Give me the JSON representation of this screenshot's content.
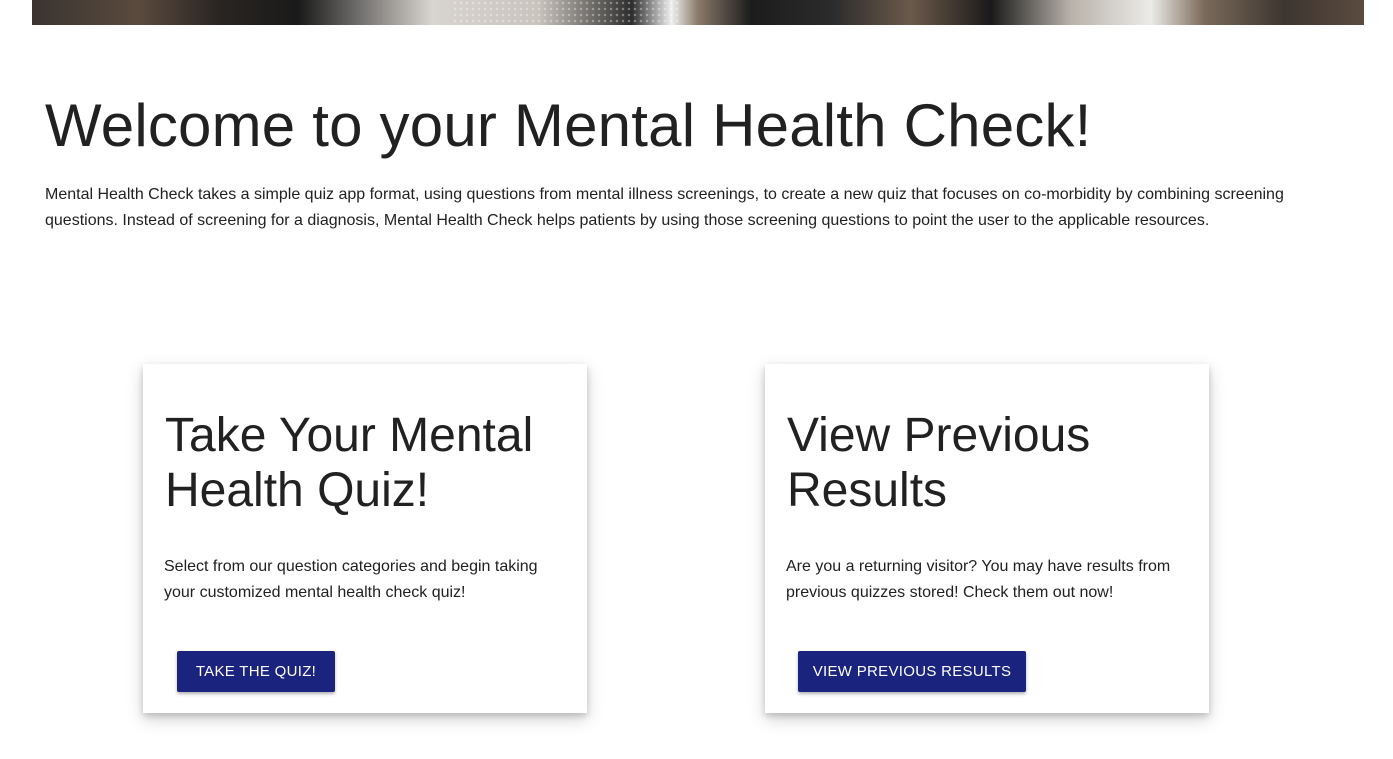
{
  "hero": {
    "image_name": "hero-photo",
    "colors": [
      "#3a3430",
      "#1a1a1a",
      "#d8d4cf",
      "#ecebe8"
    ]
  },
  "header": {
    "title": "Welcome to your Mental Health Check!"
  },
  "intro": {
    "text": "Mental Health Check takes a simple quiz app format, using questions from mental illness screenings, to create a new quiz that focuses on co-morbidity by combining screening questions. Instead of screening for a diagnosis, Mental Health Check helps patients by using those screening questions to point the user to the applicable resources."
  },
  "cards": [
    {
      "title": "Take Your Mental Health Quiz!",
      "description": "Select from our question categories and begin taking your customized mental health check quiz!",
      "button_label": "Take the Quiz!"
    },
    {
      "title": "View Previous Results",
      "description": "Are you a returning visitor? You may have results from previous quizzes stored! Check them out now!",
      "button_label": "View Previous Results"
    }
  ],
  "colors": {
    "button_bg": "#1a237e",
    "text": "#212121",
    "background": "#ffffff"
  }
}
